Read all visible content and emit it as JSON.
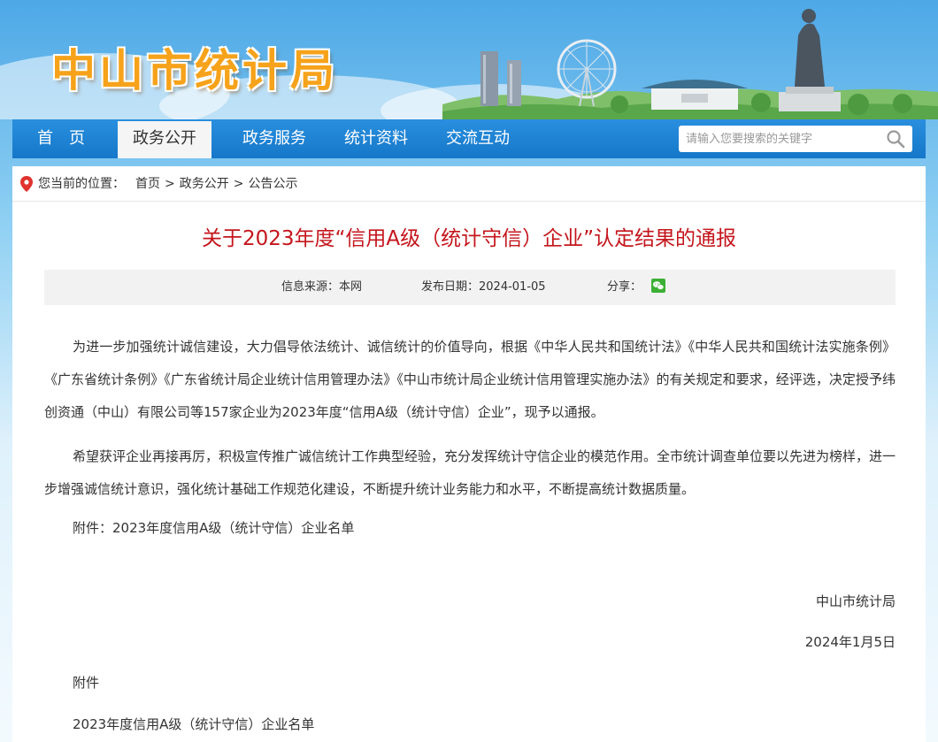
{
  "site": {
    "title": "中山市统计局"
  },
  "nav": {
    "items": [
      {
        "label": "首　页",
        "active": false
      },
      {
        "label": "政务公开",
        "active": true
      },
      {
        "label": "政务服务",
        "active": false
      },
      {
        "label": "统计资料",
        "active": false
      },
      {
        "label": "交流互动",
        "active": false
      }
    ],
    "search_placeholder": "请输入您要搜索的关键字"
  },
  "breadcrumb": {
    "label": "您当前的位置：",
    "items": [
      "首页",
      "政务公开",
      "公告公示"
    ],
    "separator": ">"
  },
  "article": {
    "title": "关于2023年度“信用A级（统计守信）企业”认定结果的通报",
    "meta": {
      "source": "信息来源：本网",
      "date": "发布日期：2024-01-05",
      "share": "分享："
    },
    "paragraphs": [
      "为进一步加强统计诚信建设，大力倡导依法统计、诚信统计的价值导向，根据《中华人民共和国统计法》《中华人民共和国统计法实施条例》《广东省统计条例》《广东省统计局企业统计信用管理办法》《中山市统计局企业统计信用管理实施办法》的有关规定和要求，经评选，决定授予纬创资通（中山）有限公司等157家企业为2023年度“信用A级（统计守信）企业”，现予以通报。",
      "希望获评企业再接再厉，积极宣传推广诚信统计工作典型经验，充分发挥统计守信企业的模范作用。全市统计调查单位要以先进为榜样，进一步增强诚信统计意识，强化统计基础工作规范化建设，不断提升统计业务能力和水平，不断提高统计数据质量。",
      "附件：2023年度信用A级（统计守信）企业名单"
    ],
    "signature_org": "中山市统计局",
    "signature_date": "2024年1月5日",
    "attachment_heading": "附件",
    "attachment_name": "2023年度信用A级（统计守信）企业名单"
  },
  "colors": {
    "brand_orange": "#f6a21a",
    "nav_blue": "#1a82d2",
    "title_red": "#c4161c",
    "wechat_green": "#3cb034"
  }
}
